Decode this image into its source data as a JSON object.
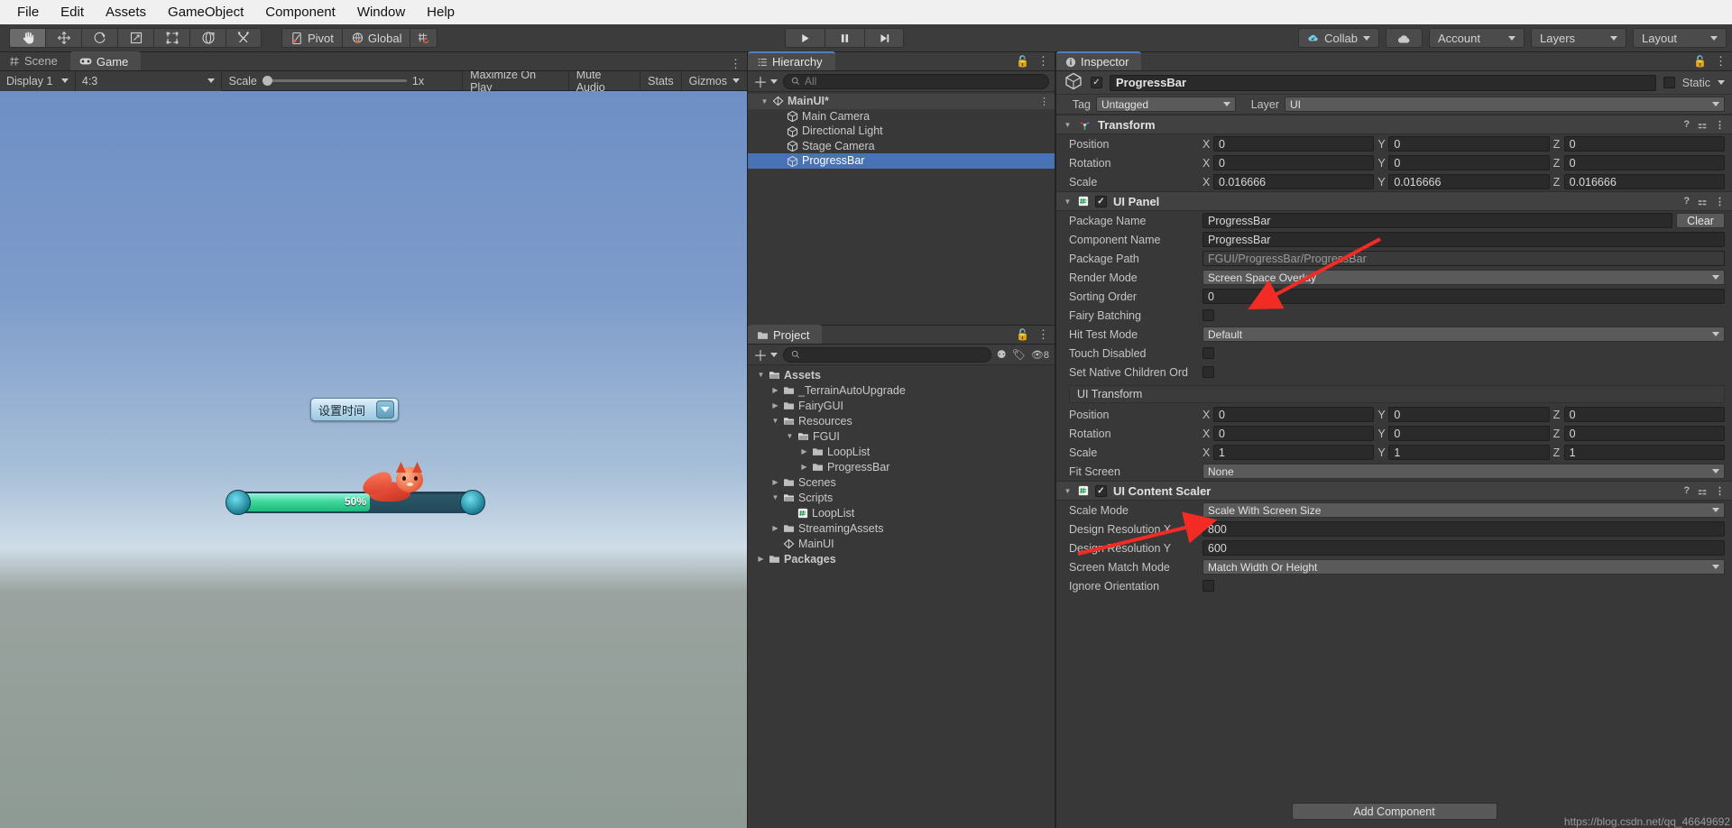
{
  "menu": {
    "items": [
      "File",
      "Edit",
      "Assets",
      "GameObject",
      "Component",
      "Window",
      "Help"
    ]
  },
  "toolbar": {
    "tools": [
      "hand-tool",
      "move-tool",
      "rotate-tool",
      "scale-tool",
      "rect-tool",
      "transform-tool",
      "custom-tool"
    ],
    "pivot_label": "Pivot",
    "global_label": "Global",
    "play_label": "play",
    "pause_label": "pause",
    "step_label": "step",
    "collab_label": "Collab",
    "cloud_label": "cloud",
    "account_label": "Account",
    "layers_label": "Layers",
    "layout_label": "Layout"
  },
  "gameview": {
    "tabs": [
      {
        "label": "Scene",
        "icon": "grid-icon",
        "active": false
      },
      {
        "label": "Game",
        "icon": "gamepad-icon",
        "active": true
      }
    ],
    "display": "Display 1",
    "aspect": "4:3",
    "scale_label": "Scale",
    "scale_value": "1x",
    "maximize_on_play": "Maximize On Play",
    "mute_audio": "Mute Audio",
    "stats": "Stats",
    "gizmos": "Gizmos",
    "dropdown_text": "设置时间",
    "progress_text": "50%"
  },
  "hierarchy": {
    "tab_label": "Hierarchy",
    "search_placeholder": "All",
    "items": [
      {
        "label": "MainUI*",
        "depth": 0,
        "icon": "scene-icon",
        "expanded": true,
        "selected": false,
        "highlight": true
      },
      {
        "label": "Main Camera",
        "depth": 1,
        "icon": "gameobject-icon",
        "selected": false
      },
      {
        "label": "Directional Light",
        "depth": 1,
        "icon": "gameobject-icon",
        "selected": false
      },
      {
        "label": "Stage Camera",
        "depth": 1,
        "icon": "gameobject-icon",
        "selected": false
      },
      {
        "label": "ProgressBar",
        "depth": 1,
        "icon": "gameobject-icon",
        "selected": true
      }
    ]
  },
  "project": {
    "tab_label": "Project",
    "search_placeholder": "",
    "badge_count": "8",
    "items": [
      {
        "label": "Assets",
        "depth": 0,
        "expanded": true,
        "icon": "folder-open-icon",
        "bold": true
      },
      {
        "label": "_TerrainAutoUpgrade",
        "depth": 1,
        "expanded": false,
        "icon": "folder-icon"
      },
      {
        "label": "FairyGUI",
        "depth": 1,
        "expanded": false,
        "icon": "folder-icon"
      },
      {
        "label": "Resources",
        "depth": 1,
        "expanded": true,
        "icon": "folder-open-icon"
      },
      {
        "label": "FGUI",
        "depth": 2,
        "expanded": true,
        "icon": "folder-open-icon"
      },
      {
        "label": "LoopList",
        "depth": 3,
        "expanded": false,
        "icon": "folder-icon"
      },
      {
        "label": "ProgressBar",
        "depth": 3,
        "expanded": false,
        "icon": "folder-icon"
      },
      {
        "label": "Scenes",
        "depth": 1,
        "expanded": false,
        "icon": "folder-icon"
      },
      {
        "label": "Scripts",
        "depth": 1,
        "expanded": true,
        "icon": "folder-open-icon"
      },
      {
        "label": "LoopList",
        "depth": 2,
        "expanded": null,
        "icon": "script-icon"
      },
      {
        "label": "StreamingAssets",
        "depth": 1,
        "expanded": false,
        "icon": "folder-icon"
      },
      {
        "label": "MainUI",
        "depth": 1,
        "expanded": null,
        "icon": "scene-icon"
      },
      {
        "label": "Packages",
        "depth": 0,
        "expanded": false,
        "icon": "folder-icon",
        "bold": true
      }
    ]
  },
  "inspector": {
    "tab_label": "Inspector",
    "object_name": "ProgressBar",
    "static_label": "Static",
    "tag_label": "Tag",
    "tag_value": "Untagged",
    "layer_label": "Layer",
    "layer_value": "UI",
    "components": [
      {
        "title": "Transform",
        "icon": "transform-icon",
        "has_checkbox": false,
        "rows": [
          {
            "label": "Position",
            "type": "vector3",
            "x": "0",
            "y": "0",
            "z": "0"
          },
          {
            "label": "Rotation",
            "type": "vector3",
            "x": "0",
            "y": "0",
            "z": "0"
          },
          {
            "label": "Scale",
            "type": "vector3",
            "x": "0.016666",
            "y": "0.016666",
            "z": "0.016666"
          }
        ]
      },
      {
        "title": "UI Panel",
        "icon": "script-icon",
        "has_checkbox": true,
        "checked": true,
        "rows": [
          {
            "label": "Package Name",
            "type": "text-button",
            "value": "ProgressBar",
            "button": "Clear"
          },
          {
            "label": "Component Name",
            "type": "text",
            "value": "ProgressBar"
          },
          {
            "label": "Package Path",
            "type": "readonly",
            "value": "FGUI/ProgressBar/ProgressBar"
          },
          {
            "label": "Render Mode",
            "type": "dropdown",
            "value": "Screen Space Overlay"
          },
          {
            "label": "Sorting Order",
            "type": "text",
            "value": "0"
          },
          {
            "label": "Fairy Batching",
            "type": "checkbox",
            "checked": false
          },
          {
            "label": "Hit Test Mode",
            "type": "dropdown",
            "value": "Default"
          },
          {
            "label": "Touch Disabled",
            "type": "checkbox",
            "checked": false
          },
          {
            "label": "Set Native Children Ord",
            "type": "checkbox",
            "checked": false
          },
          {
            "label": "UI Transform",
            "type": "section"
          },
          {
            "label": "Position",
            "type": "vector3",
            "x": "0",
            "y": "0",
            "z": "0"
          },
          {
            "label": "Rotation",
            "type": "vector3",
            "x": "0",
            "y": "0",
            "z": "0"
          },
          {
            "label": "Scale",
            "type": "vector3",
            "x": "1",
            "y": "1",
            "z": "1"
          },
          {
            "label": "Fit Screen",
            "type": "dropdown",
            "value": "None"
          }
        ]
      },
      {
        "title": "UI Content Scaler",
        "icon": "script-icon",
        "has_checkbox": true,
        "checked": true,
        "rows": [
          {
            "label": "Scale Mode",
            "type": "dropdown",
            "value": "Scale With Screen Size"
          },
          {
            "label": "Design Resolution X",
            "type": "text",
            "value": "800"
          },
          {
            "label": "Design Resolution Y",
            "type": "text",
            "value": "600"
          },
          {
            "label": "Screen Match Mode",
            "type": "dropdown",
            "value": "Match Width Or Height"
          },
          {
            "label": "Ignore Orientation",
            "type": "checkbox",
            "checked": false
          }
        ]
      }
    ],
    "add_component": "Add Component"
  },
  "watermark": "https://blog.csdn.net/qq_46649692",
  "colors": {
    "accent_blue": "#4772b3",
    "arrow_red": "#f22c24",
    "panel_bg": "#383838",
    "toolbar_bg": "#3c3c3c"
  }
}
